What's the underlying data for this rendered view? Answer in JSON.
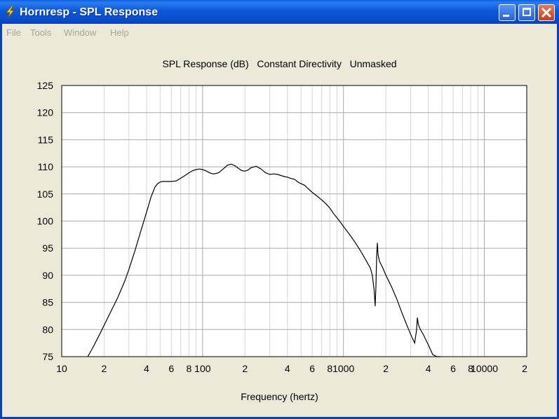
{
  "window": {
    "title": "Hornresp - SPL Response",
    "icon": "lightning-bolt-icon",
    "buttons": [
      "minimize-icon",
      "maximize-icon",
      "close-icon"
    ]
  },
  "menu": [
    "File",
    "Tools",
    "Window",
    "Help"
  ],
  "colors": {
    "titlebar": "#0a4fd0",
    "background": "#ece9d8",
    "plot_area": "#ffffff",
    "trace": "#000000",
    "grid_major": "#a9a9a9",
    "grid_minor": "#d6d6d6"
  },
  "chart_data": {
    "type": "line",
    "title": "SPL Response (dB)   Constant Directivity   Unmasked",
    "xlabel": "Frequency (hertz)",
    "ylabel": "",
    "xscale": "log",
    "xlim": [
      10,
      20000
    ],
    "ylim": [
      75,
      125
    ],
    "grid": true,
    "yticks": [
      75,
      80,
      85,
      90,
      95,
      100,
      105,
      110,
      115,
      120,
      125
    ],
    "xtick_labels": [
      {
        "value": 10,
        "label": "10"
      },
      {
        "value": 20,
        "label": "2"
      },
      {
        "value": 40,
        "label": "4"
      },
      {
        "value": 60,
        "label": "6"
      },
      {
        "value": 80,
        "label": "8"
      },
      {
        "value": 100,
        "label": "100"
      },
      {
        "value": 200,
        "label": "2"
      },
      {
        "value": 400,
        "label": "4"
      },
      {
        "value": 600,
        "label": "6"
      },
      {
        "value": 800,
        "label": "8"
      },
      {
        "value": 1000,
        "label": "1000"
      },
      {
        "value": 2000,
        "label": "2"
      },
      {
        "value": 4000,
        "label": "4"
      },
      {
        "value": 6000,
        "label": "6"
      },
      {
        "value": 8000,
        "label": "8"
      },
      {
        "value": 10000,
        "label": "10000"
      },
      {
        "value": 20000,
        "label": "2"
      }
    ],
    "series": [
      {
        "x": [
          15.3,
          16.5,
          18,
          20,
          22,
          25,
          28,
          30,
          33,
          36,
          40,
          43,
          46,
          48,
          50,
          52,
          55,
          60,
          65,
          70,
          75,
          80,
          85,
          90,
          95,
          100,
          105,
          110,
          115,
          120,
          130,
          140,
          150,
          160,
          170,
          180,
          190,
          200,
          210,
          220,
          240,
          260,
          280,
          300,
          320,
          340,
          360,
          380,
          400,
          420,
          450,
          480,
          500,
          530,
          560,
          600,
          650,
          700,
          750,
          800,
          850,
          900,
          950,
          1000,
          1100,
          1200,
          1300,
          1400,
          1500,
          1550,
          1600,
          1650,
          1680,
          1700,
          1720,
          1740,
          1760,
          1800,
          1900,
          2000,
          2200,
          2400,
          2600,
          2800,
          3000,
          3200,
          3300,
          3350,
          3400,
          3450,
          3500,
          3700,
          4000,
          4300,
          4600,
          4900
        ],
        "y": [
          75,
          76.5,
          78.4,
          80.8,
          83,
          85.9,
          88.9,
          91.1,
          94.4,
          97.7,
          101.6,
          104.4,
          106.3,
          106.9,
          107.2,
          107.3,
          107.3,
          107.3,
          107.4,
          107.9,
          108.4,
          108.9,
          109.3,
          109.5,
          109.6,
          109.5,
          109.3,
          109,
          108.8,
          108.7,
          108.9,
          109.6,
          110.3,
          110.5,
          110.2,
          109.7,
          109.3,
          109.2,
          109.4,
          109.8,
          110.1,
          109.6,
          108.9,
          108.6,
          108.7,
          108.6,
          108.4,
          108.2,
          108.1,
          107.9,
          107.7,
          107.1,
          106.9,
          106.6,
          106,
          105.3,
          104.6,
          103.9,
          103.2,
          102.4,
          101.4,
          100.6,
          99.8,
          99,
          97.6,
          96.2,
          94.8,
          93.4,
          92,
          91.4,
          90.1,
          87.3,
          84.3,
          88,
          93.5,
          96,
          93.8,
          92.6,
          91.4,
          90,
          87.8,
          85.5,
          83.1,
          81,
          79.1,
          77.5,
          79.8,
          82.2,
          81,
          80.5,
          80.1,
          79,
          77.2,
          75.4,
          73.8,
          72.5
        ]
      }
    ]
  }
}
